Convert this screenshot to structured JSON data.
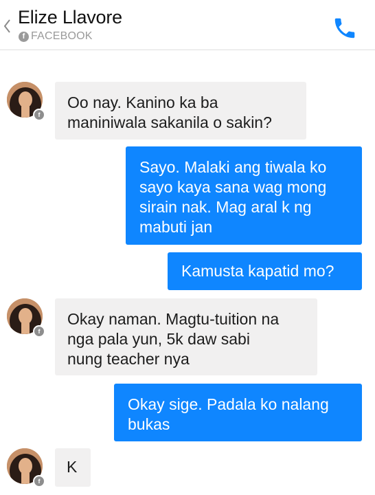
{
  "header": {
    "contact_name": "Elize Llavore",
    "source_label": "FACEBOOK",
    "back_icon": "chevron-left-icon",
    "call_icon": "phone-icon"
  },
  "colors": {
    "outgoing_bubble": "#0f86ff",
    "incoming_bubble": "#f1f0f0",
    "call_icon": "#0f86ff"
  },
  "messages": [
    {
      "direction": "incoming",
      "lines": [
        "Oo nay. Kanino ka ba",
        "maniniwala sakanila o sakin?"
      ]
    },
    {
      "direction": "outgoing",
      "lines": [
        "Sayo. Malaki ang tiwala ko",
        "sayo kaya sana wag mong",
        "sirain nak. Mag aral k ng",
        "mabuti jan"
      ]
    },
    {
      "direction": "outgoing",
      "lines": [
        "Kamusta kapatid mo?"
      ]
    },
    {
      "direction": "incoming",
      "lines": [
        "Okay naman. Magtu-tuition na",
        "nga pala yun, 5k daw sabi",
        "nung teacher nya"
      ]
    },
    {
      "direction": "outgoing",
      "lines": [
        "Okay sige. Padala ko nalang",
        "bukas"
      ]
    },
    {
      "direction": "incoming",
      "lines": [
        "K"
      ]
    }
  ]
}
